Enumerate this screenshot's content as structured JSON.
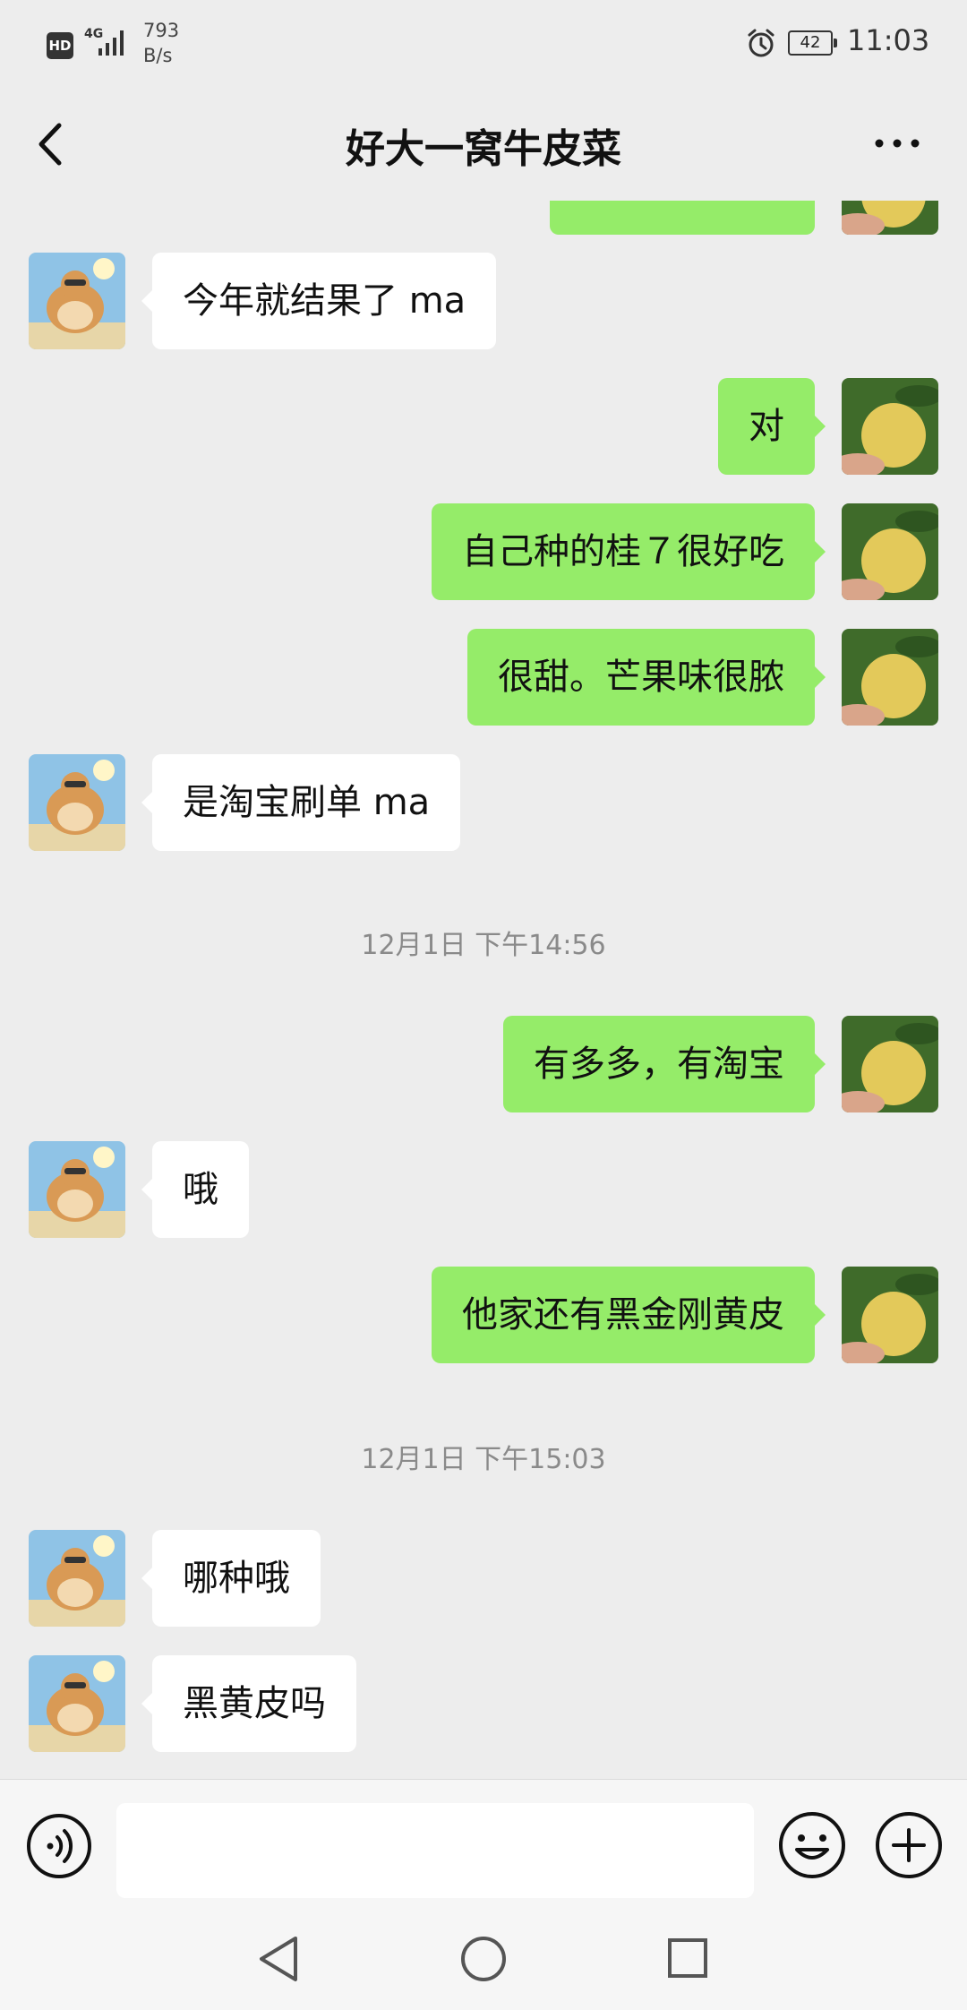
{
  "status_bar": {
    "hd": "HD",
    "network": "4G",
    "speed_value": "793",
    "speed_unit": "B/s",
    "battery": "42",
    "time": "11:03"
  },
  "header": {
    "title": "好大一窝牛皮菜"
  },
  "messages": [
    {
      "from": "contact",
      "text": "今年就结果了 ma"
    },
    {
      "from": "me",
      "text": "对"
    },
    {
      "from": "me",
      "text": "自己种的桂７很好吃"
    },
    {
      "from": "me",
      "text": "很甜。芒果味很脓"
    },
    {
      "from": "contact",
      "text": "是淘宝刷单 ma"
    },
    {
      "timestamp": "12月1日 下午14:56"
    },
    {
      "from": "me",
      "text": "有多多，有淘宝"
    },
    {
      "from": "contact",
      "text": "哦"
    },
    {
      "from": "me",
      "text": "他家还有黑金刚黄皮"
    },
    {
      "timestamp": "12月1日 下午15:03"
    },
    {
      "from": "contact",
      "text": "哪种哦"
    },
    {
      "from": "contact",
      "text": "黑黄皮吗"
    }
  ],
  "input_bar": {
    "placeholder": "",
    "icons": [
      "voice-icon",
      "emoji-icon",
      "plus-icon"
    ]
  },
  "nav_bar": {
    "icons": [
      "nav-back-icon",
      "nav-home-icon",
      "nav-recent-icon"
    ]
  },
  "colors": {
    "background": "#ededed",
    "sent_bubble": "#95ec69",
    "received_bubble": "#ffffff",
    "timestamp": "#8a8a8a"
  }
}
